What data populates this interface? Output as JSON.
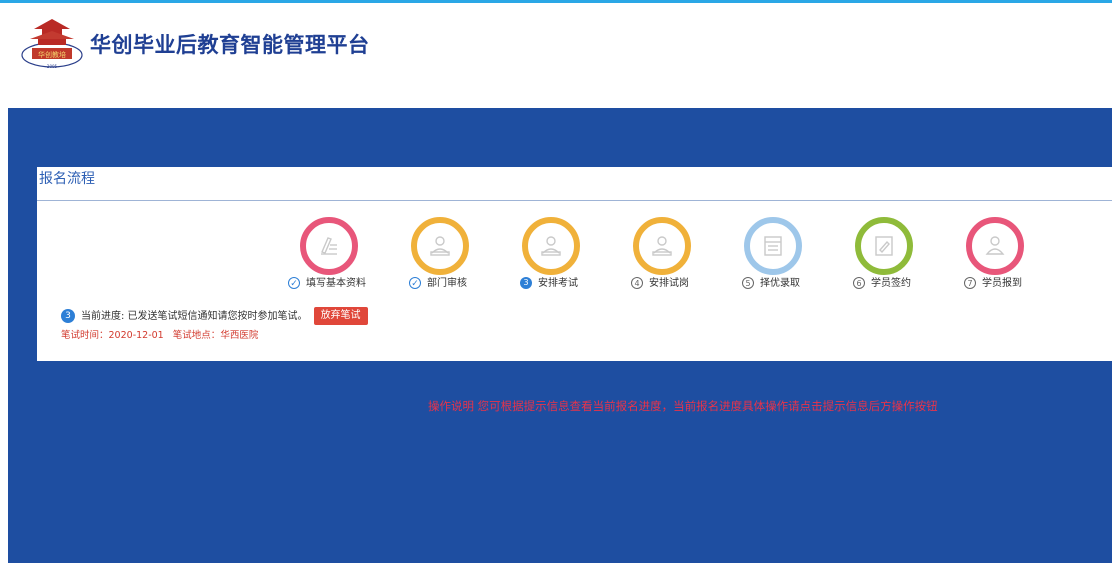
{
  "header": {
    "site_title": "华创毕业后教育智能管理平台",
    "logo_icon": "pagoda-logo-icon",
    "logo_text": "华创教培"
  },
  "panel": {
    "title": "报名流程",
    "steps": [
      {
        "label": "填写基本资料",
        "status": "done",
        "num": "✓",
        "icon": "pen-document-icon",
        "color": "#e8567a"
      },
      {
        "label": "部门审核",
        "status": "done",
        "num": "✓",
        "icon": "reviewer-icon",
        "color": "#f0b13a"
      },
      {
        "label": "安排考试",
        "status": "current",
        "num": "3",
        "icon": "reviewer-icon",
        "color": "#f0b13a"
      },
      {
        "label": "安排试岗",
        "status": "todo",
        "num": "4",
        "icon": "reviewer-icon",
        "color": "#f0b13a"
      },
      {
        "label": "择优录取",
        "status": "todo",
        "num": "5",
        "icon": "notice-icon",
        "color": "#9ec7ea"
      },
      {
        "label": "学员签约",
        "status": "todo",
        "num": "6",
        "icon": "contract-icon",
        "color": "#8fbb3a"
      },
      {
        "label": "学员报到",
        "status": "todo",
        "num": "7",
        "icon": "user-icon",
        "color": "#e8567a"
      }
    ],
    "progress": {
      "badge": "3",
      "text": "当前进度: 已发送笔试短信通知请您按时参加笔试。",
      "abandon_label": "放弃笔试"
    },
    "exam": {
      "time_label": "笔试时间：",
      "time_value": "2020-12-01",
      "place_label": "笔试地点：",
      "place_value": "华西医院"
    }
  },
  "note": "操作说明    您可根据提示信息查看当前报名进度，当前报名进度具体操作请点击提示信息后方操作按钮"
}
